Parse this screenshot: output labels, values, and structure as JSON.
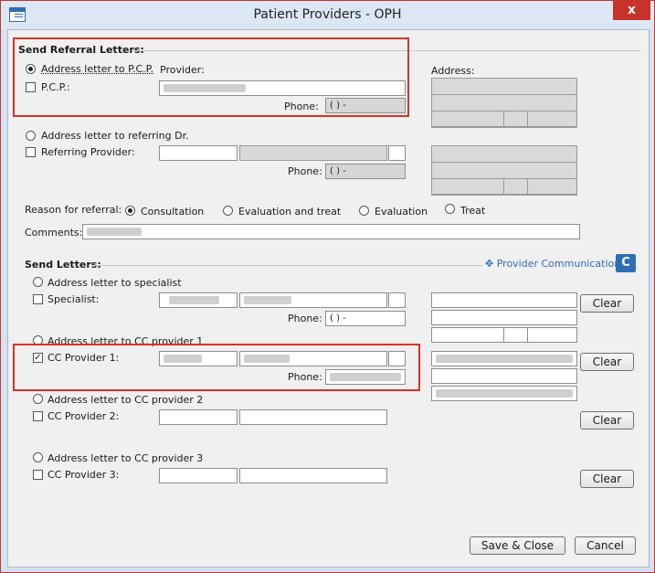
{
  "window": {
    "title": "Patient Providers - OPH",
    "close_glyph": "x"
  },
  "referral": {
    "section_title": "Send Referral Letters:",
    "address_pcp_label": "Address letter to P.C.P.",
    "pcp_label": "P.C.P.:",
    "provider_label": "Provider:",
    "address_label": "Address:",
    "phone_label": "Phone:",
    "pcp_phone": "(  )  -",
    "address_referring_label": "Address letter to referring Dr.",
    "referring_provider_label": "Referring Provider:",
    "referring_phone": "(  )  -",
    "reason_label": "Reason for referral:",
    "reasons": [
      "Consultation",
      "Evaluation and treat",
      "Evaluation",
      "Treat"
    ],
    "comments_label": "Comments:"
  },
  "letters": {
    "section_title": "Send Letters:",
    "provider_communication": "Provider Communication",
    "specialist_radio": "Address letter to specialist",
    "specialist_label": "Specialist:",
    "specialist_phone": "(  )  -",
    "cc1_radio": "Address letter to CC provider 1",
    "cc1_label": "CC Provider 1:",
    "cc1_checkmark": "✓",
    "cc2_radio": "Address letter to CC provider 2",
    "cc2_label": "CC Provider 2:",
    "cc3_radio": "Address letter to CC provider 3",
    "cc3_label": "CC Provider 3:",
    "phone_label": "Phone:",
    "clear_label": "Clear"
  },
  "footer": {
    "save_close": "Save & Close",
    "cancel": "Cancel"
  }
}
